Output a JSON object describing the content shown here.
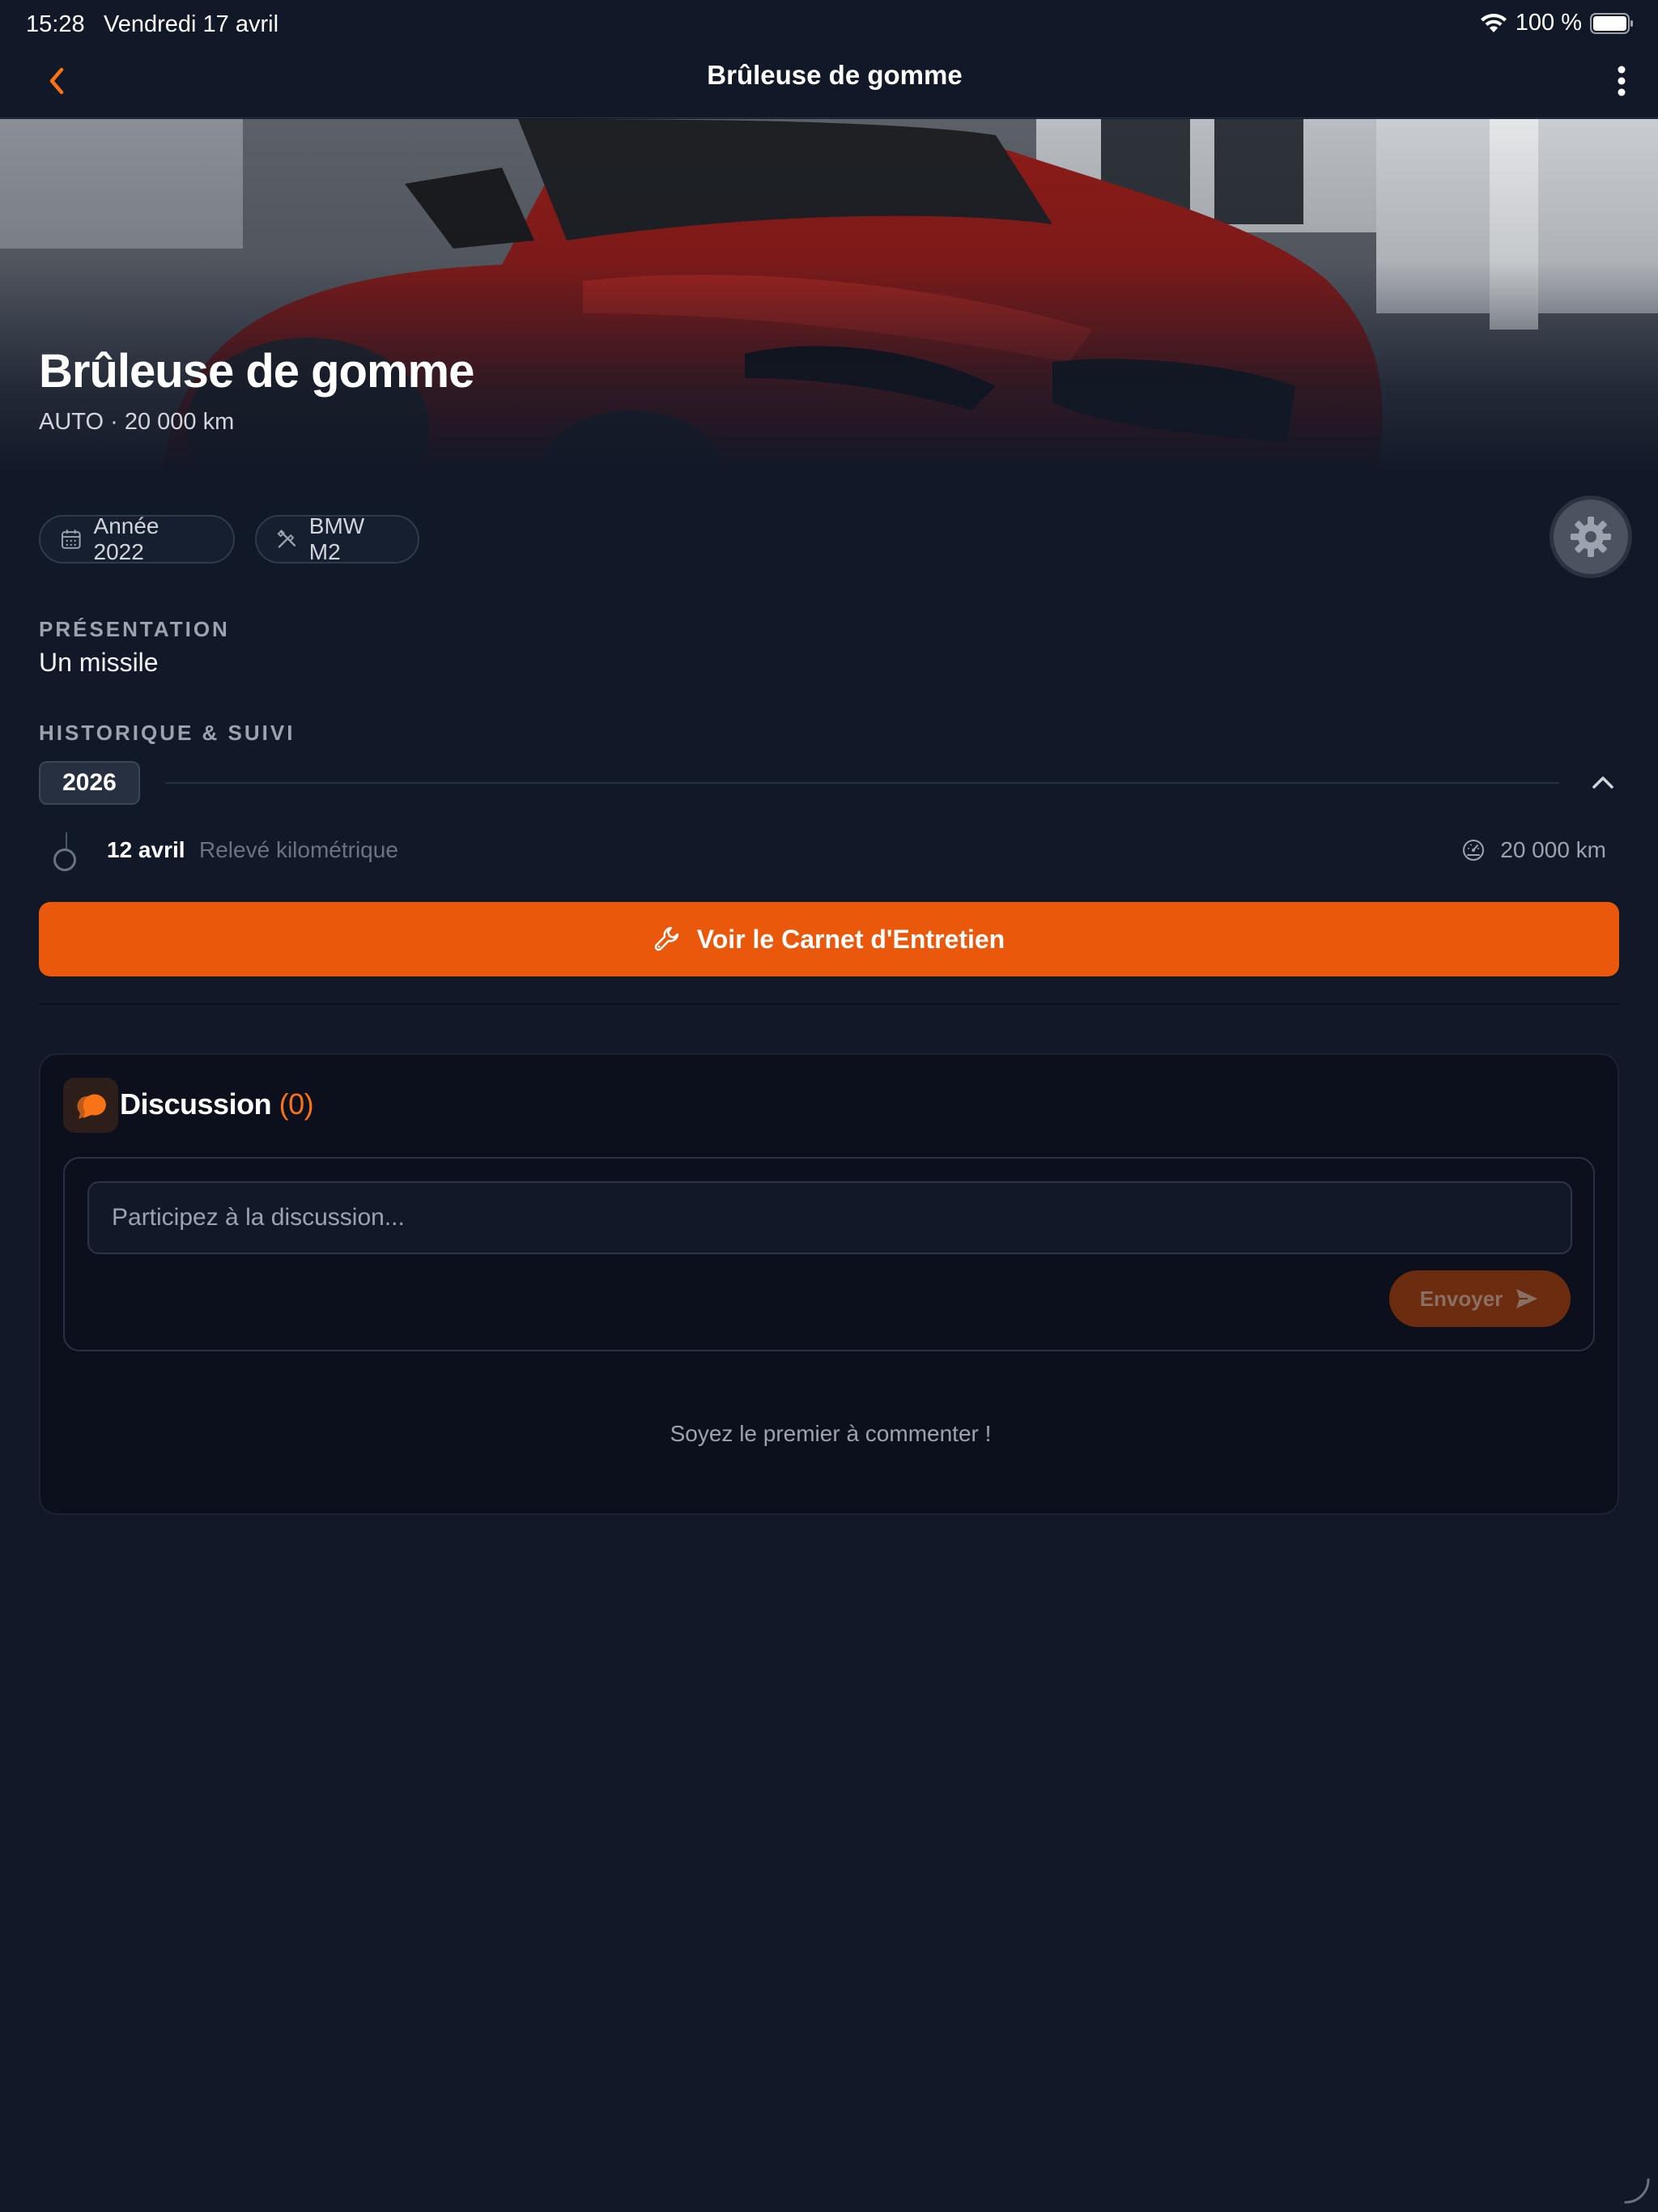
{
  "status_bar": {
    "time": "15:28",
    "date": "Vendredi 17 avril",
    "battery": "100 %"
  },
  "nav": {
    "title": "Brûleuse de gomme"
  },
  "hero": {
    "title": "Brûleuse de gomme",
    "category": "AUTO",
    "separator": "·",
    "mileage": "20 000 km"
  },
  "chips": {
    "year": "Année 2022",
    "model": "BMW M2"
  },
  "presentation": {
    "label": "PRÉSENTATION",
    "text": "Un missile"
  },
  "history": {
    "label": "HISTORIQUE & SUIVI",
    "year": "2026",
    "entries": [
      {
        "date": "12 avril",
        "type": "Relevé kilométrique",
        "km": "20 000 km"
      }
    ]
  },
  "cta": {
    "label": "Voir le Carnet d'Entretien"
  },
  "discussion": {
    "title": "Discussion",
    "count": "(0)",
    "placeholder": "Participez à la discussion...",
    "send_label": "Envoyer",
    "empty_text": "Soyez le premier à commenter !"
  },
  "colors": {
    "background": "#111827",
    "accent": "#ea580c",
    "accent_text": "#f97316",
    "card": "#0b101c"
  },
  "icons": {
    "back": "chevron-left-icon",
    "more": "more-vertical-icon",
    "year_chip": "calendar-icon",
    "model_chip": "tools-icon",
    "settings": "gear-icon",
    "collapse": "chevron-up-icon",
    "km": "speedometer-icon",
    "cta": "wrench-icon",
    "discussion": "chat-bubbles-icon",
    "send": "send-icon"
  }
}
